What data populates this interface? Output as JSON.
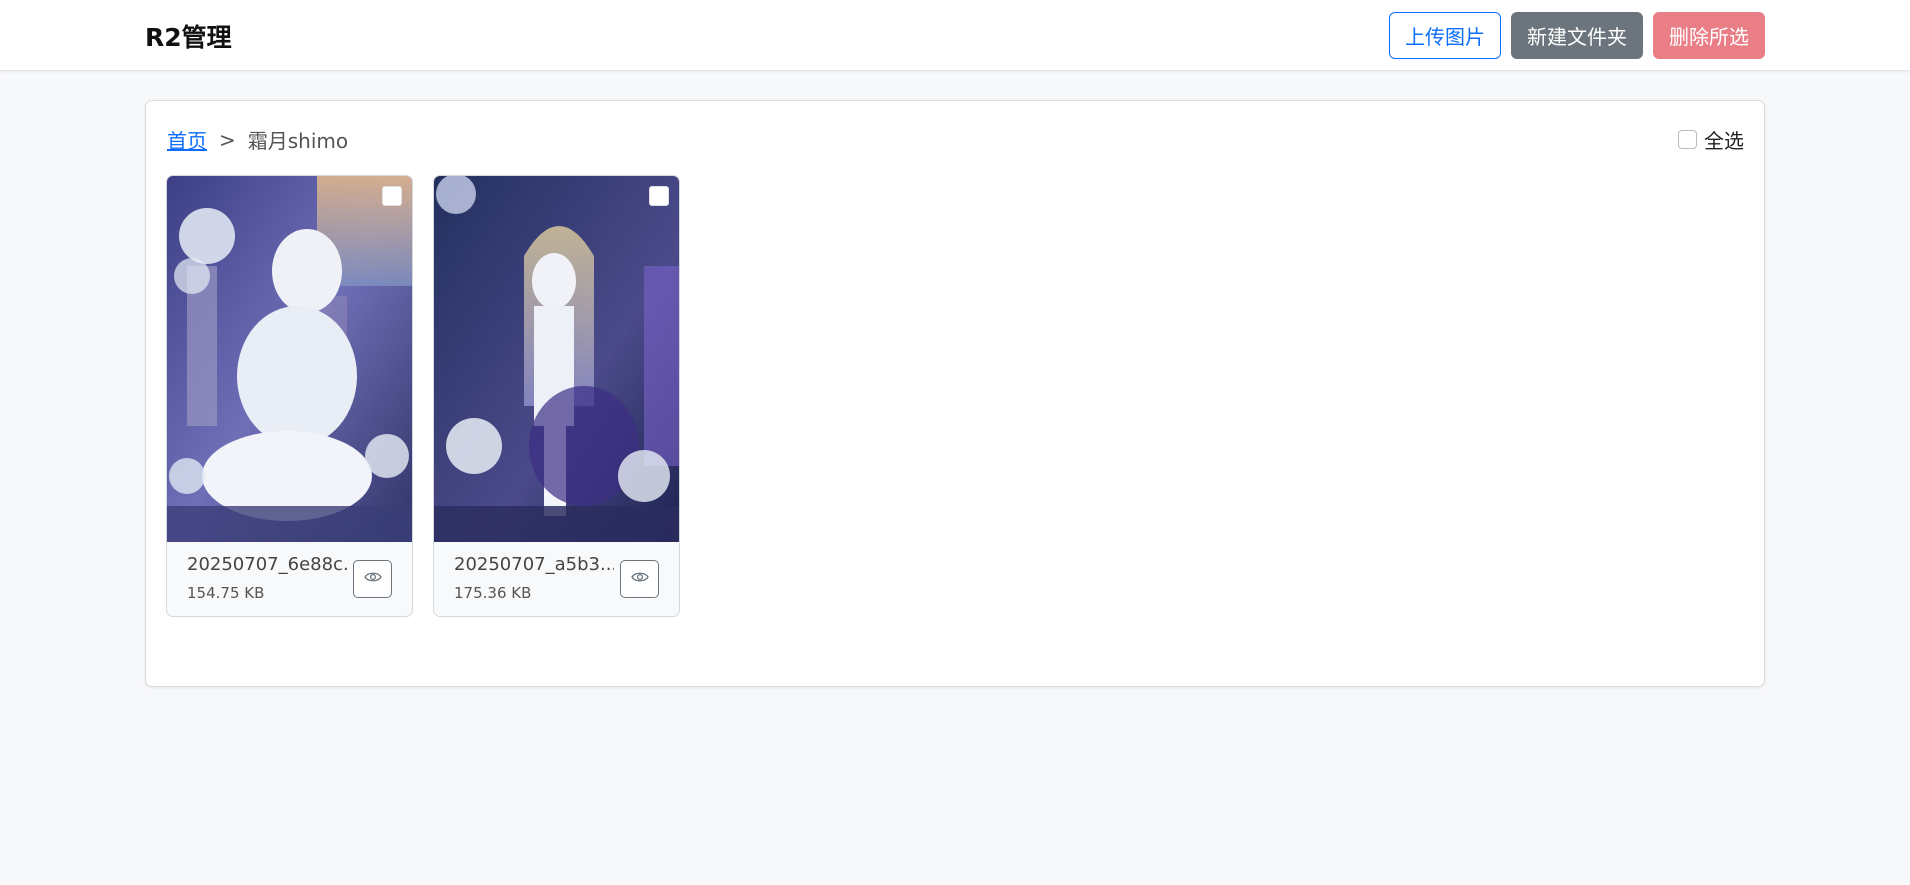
{
  "app": {
    "title": "R2管理"
  },
  "toolbar": {
    "upload_label": "上传图片",
    "new_folder_label": "新建文件夹",
    "delete_selected_label": "删除所选"
  },
  "breadcrumb": {
    "home": "首页",
    "separator": ">",
    "current": "霜月shimo"
  },
  "select_all_label": "全选",
  "files": [
    {
      "name": "20250707_6e88c...",
      "size": "154.75 KB",
      "view_icon": "eye-icon",
      "selected": false
    },
    {
      "name": "20250707_a5b3...",
      "size": "175.36 KB",
      "view_icon": "eye-icon",
      "selected": false
    }
  ],
  "colors": {
    "primary": "#0d6efd",
    "secondary": "#6c757d",
    "danger_muted": "#e97e87",
    "background": "#f7f8fa"
  }
}
